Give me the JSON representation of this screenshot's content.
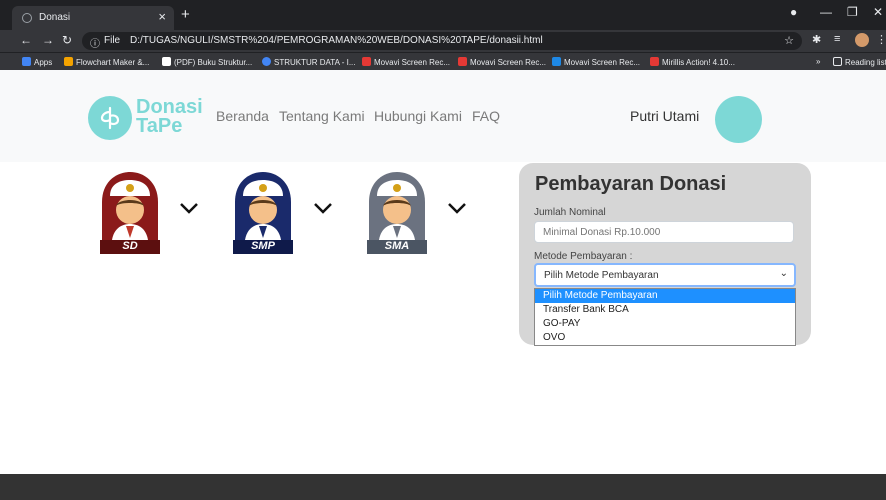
{
  "browser": {
    "tab_title": "Donasi",
    "tab_close": "×",
    "new_tab": "+",
    "url_scheme": "File",
    "url_path": "D:/TUGAS/NGULI/SMSTR%204/PEMROGRAMAN%20WEB/DONASI%20TAPE/donasii.html",
    "bookmarks": [
      {
        "label": "Apps",
        "color": "#e8eaed"
      },
      {
        "label": "Flowchart Maker &...",
        "color": "#f4a300"
      },
      {
        "label": "(PDF) Buku Struktur...",
        "color": "#ffffff"
      },
      {
        "label": "STRUKTUR DATA - I...",
        "color": "#4285f4"
      },
      {
        "label": "Movavi Screen Rec...",
        "color": "#e53935"
      },
      {
        "label": "Movavi Screen Rec...",
        "color": "#e53935"
      },
      {
        "label": "Movavi Screen Rec...",
        "color": "#1e88e5"
      },
      {
        "label": "Mirillis Action! 4.10...",
        "color": "#e53935"
      }
    ],
    "more_bookmarks": "»",
    "reading_list": "Reading list"
  },
  "navbar": {
    "logo_line1": "Donasi",
    "logo_line2": "TaPe",
    "menu": [
      "Beranda",
      "Tentang Kami",
      "Hubungi Kami",
      "FAQ"
    ],
    "username": "Putri Utami"
  },
  "levels": [
    {
      "label": "SD",
      "color": "#8b1a1a"
    },
    {
      "label": "SMP",
      "color": "#1a2a6b"
    },
    {
      "label": "SMA",
      "color": "#6b7280"
    }
  ],
  "form": {
    "title": "Pembayaran Donasi",
    "amount_label": "Jumlah Nominal",
    "amount_placeholder": "Minimal Donasi Rp.10.000",
    "method_label": "Metode Pembayaran :",
    "method_selected": "Pilih Metode Pembayaran",
    "method_options": [
      "Pilih Metode Pembayaran",
      "Transfer Bank BCA",
      "GO-PAY",
      "OVO"
    ]
  },
  "colors": {
    "accent": "#7dd8d6",
    "card": "#d6d6d6",
    "footer": "#333333"
  }
}
